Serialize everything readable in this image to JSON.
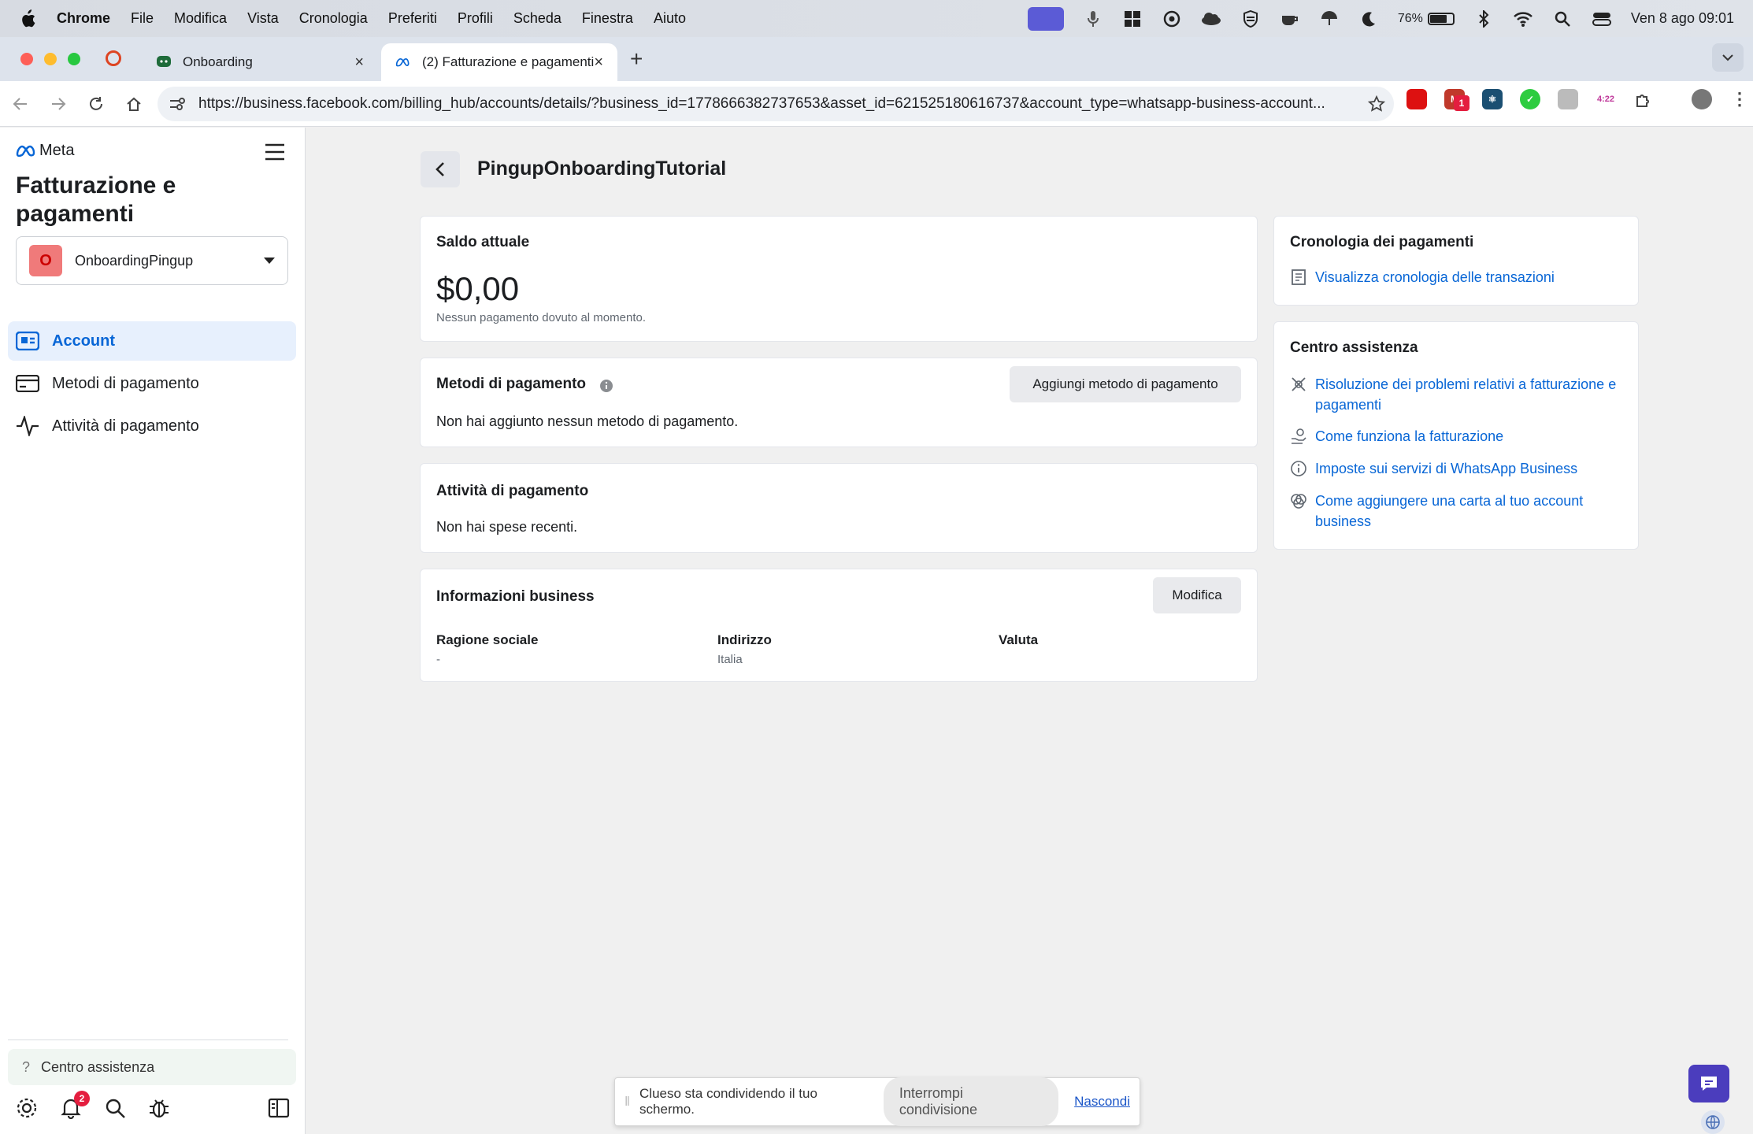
{
  "menubar": {
    "app": "Chrome",
    "items": [
      "File",
      "Modifica",
      "Vista",
      "Cronologia",
      "Preferiti",
      "Profili",
      "Scheda",
      "Finestra",
      "Aiuto"
    ],
    "battery": "76%",
    "datetime": "Ven 8 ago  09:01"
  },
  "tabs": [
    {
      "label": "Onboarding"
    },
    {
      "label": "(2) Fatturazione e pagamenti"
    }
  ],
  "address": {
    "url": "https://business.facebook.com/billing_hub/accounts/details/?business_id=1778666382737653&asset_id=621525180616737&account_type=whatsapp-business-account..."
  },
  "extensions": {
    "badge_count": "1",
    "timer": "4:22"
  },
  "sidebar": {
    "logo": "Meta",
    "title": "Fatturazione e pagamenti",
    "account": {
      "initial": "O",
      "name": "OnboardingPingup"
    },
    "nav": [
      {
        "label": "Account"
      },
      {
        "label": "Metodi di pagamento"
      },
      {
        "label": "Attività di pagamento"
      }
    ],
    "help": "Centro assistenza",
    "notification_count": "2"
  },
  "main": {
    "title": "PingupOnboardingTutorial",
    "balance": {
      "heading": "Saldo attuale",
      "amount": "$0,00",
      "note": "Nessun pagamento dovuto al momento."
    },
    "methods": {
      "heading": "Metodi di pagamento",
      "add_button": "Aggiungi metodo di pagamento",
      "empty": "Non hai aggiunto nessun metodo di pagamento."
    },
    "activity": {
      "heading": "Attività di pagamento",
      "empty": "Non hai spese recenti."
    },
    "business": {
      "heading": "Informazioni business",
      "edit_button": "Modifica",
      "fields": [
        {
          "label": "Ragione sociale",
          "value": "-"
        },
        {
          "label": "Indirizzo",
          "value": "Italia"
        },
        {
          "label": "Valuta",
          "value": ""
        }
      ]
    },
    "history": {
      "heading": "Cronologia dei pagamenti",
      "link": "Visualizza cronologia delle transazioni"
    },
    "help_center": {
      "heading": "Centro assistenza",
      "links": [
        "Risoluzione dei problemi relativi a fatturazione e pagamenti",
        "Come funziona la fatturazione",
        "Imposte sui servizi di WhatsApp Business",
        "Come aggiungere una carta al tuo account business"
      ]
    }
  },
  "sharebar": {
    "message": "Clueso sta condividendo il tuo schermo.",
    "stop": "Interrompi condivisione",
    "hide": "Nascondi"
  },
  "colors": {
    "accent": "#0866d6",
    "nav_active_bg": "#e7f0fd",
    "avatar_bg": "#f07a7a",
    "chat_fab": "#4b3dbd"
  }
}
